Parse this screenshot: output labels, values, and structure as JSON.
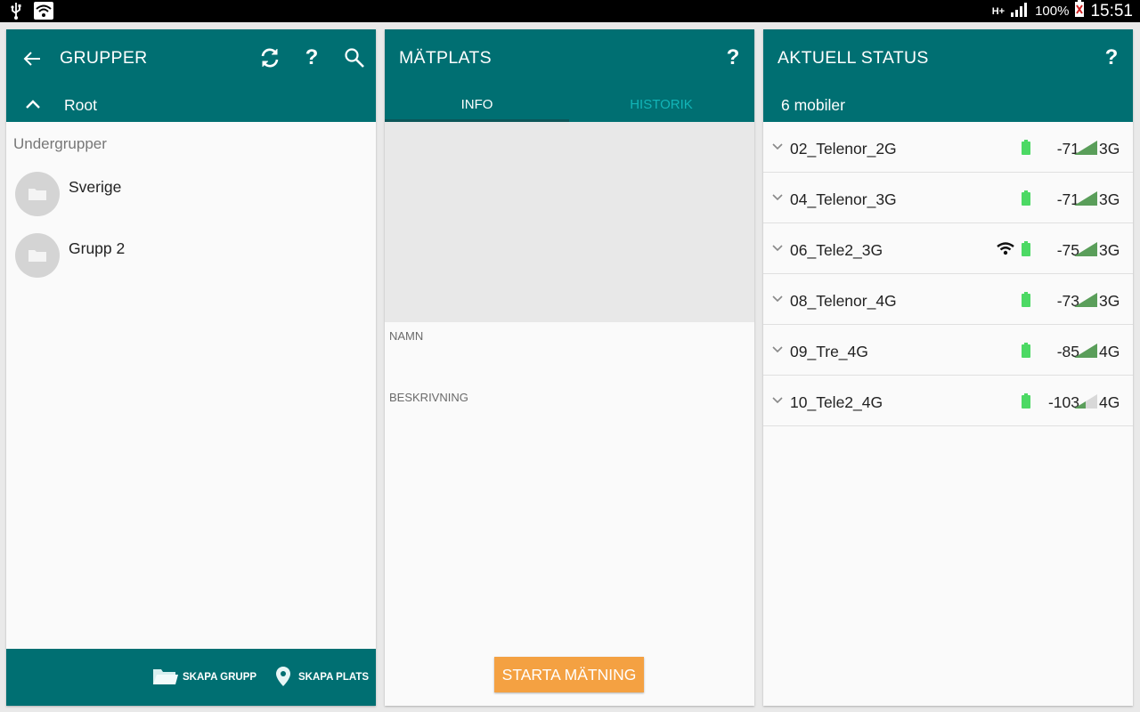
{
  "status_bar": {
    "network_type": "H+",
    "battery_pct": "100%",
    "time": "15:51",
    "icons": [
      "usb-icon",
      "wifi-icon",
      "signal-icon",
      "battery-icon"
    ]
  },
  "groups_panel": {
    "title": "GRUPPER",
    "breadcrumb": "Root",
    "subgroups_label": "Undergrupper",
    "groups": [
      {
        "name": "Sverige"
      },
      {
        "name": "Grupp 2"
      }
    ],
    "footer": {
      "create_group": "SKAPA GRUPP",
      "create_place": "SKAPA PLATS"
    }
  },
  "place_panel": {
    "title": "MÄTPLATS",
    "tabs": [
      {
        "label": "INFO",
        "active": true
      },
      {
        "label": "HISTORIK",
        "active": false
      }
    ],
    "name_label": "NAMN",
    "description_label": "BESKRIVNING",
    "start_button": "STARTA MÄTNING"
  },
  "status_panel": {
    "title": "AKTUELL STATUS",
    "subtitle": "6 mobiler",
    "devices": [
      {
        "name": "02_Telenor_2G",
        "wifi": false,
        "rssi": "-71",
        "signal": 1.0,
        "network": "3G"
      },
      {
        "name": "04_Telenor_3G",
        "wifi": false,
        "rssi": "-71",
        "signal": 1.0,
        "network": "3G"
      },
      {
        "name": "06_Tele2_3G",
        "wifi": true,
        "rssi": "-75",
        "signal": 1.0,
        "network": "3G"
      },
      {
        "name": "08_Telenor_4G",
        "wifi": false,
        "rssi": "-73",
        "signal": 1.0,
        "network": "3G"
      },
      {
        "name": "09_Tre_4G",
        "wifi": false,
        "rssi": "-85",
        "signal": 1.0,
        "network": "4G"
      },
      {
        "name": "10_Tele2_4G",
        "wifi": false,
        "rssi": "-103",
        "signal": 0.5,
        "network": "4G"
      }
    ]
  },
  "colors": {
    "header": "#006f72",
    "accent_button": "#f4a142",
    "battery": "#4cd964",
    "signal": "#5a9e5a",
    "inactive_tab": "#12b5b8"
  }
}
